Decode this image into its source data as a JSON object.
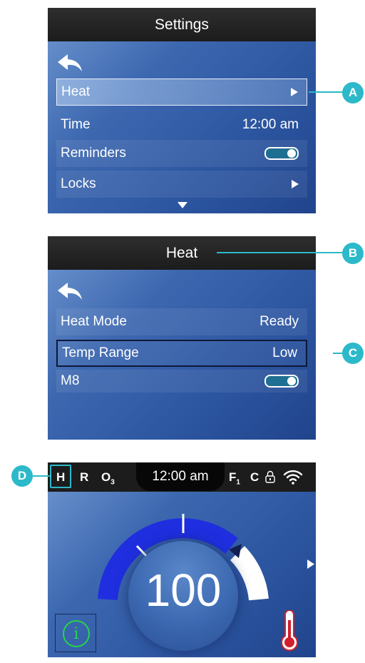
{
  "settings_screen": {
    "title": "Settings",
    "items": [
      {
        "label": "Heat",
        "value": ""
      },
      {
        "label": "Time",
        "value": "12:00 am"
      },
      {
        "label": "Reminders",
        "value": ""
      },
      {
        "label": "Locks",
        "value": ""
      }
    ]
  },
  "heat_screen": {
    "title": "Heat",
    "items": [
      {
        "label": "Heat Mode",
        "value": "Ready"
      },
      {
        "label": "Temp Range",
        "value": "Low"
      },
      {
        "label": "M8",
        "value": ""
      }
    ]
  },
  "main_screen": {
    "status": {
      "heat": "H",
      "ready": "R",
      "ozone": "O",
      "ozone_sub": "3",
      "time": "12:00 am",
      "filter": "F",
      "filter_sub": "1",
      "unit": "C"
    },
    "temperature": "100",
    "info_label": "i"
  },
  "callouts": {
    "a": "A",
    "b": "B",
    "c": "C",
    "d": "D"
  },
  "colors": {
    "accent": "#2cb9c9",
    "gauge_blue": "#1f2fe0",
    "info_green": "#25d44b",
    "thermometer_red": "#d11f2d"
  }
}
